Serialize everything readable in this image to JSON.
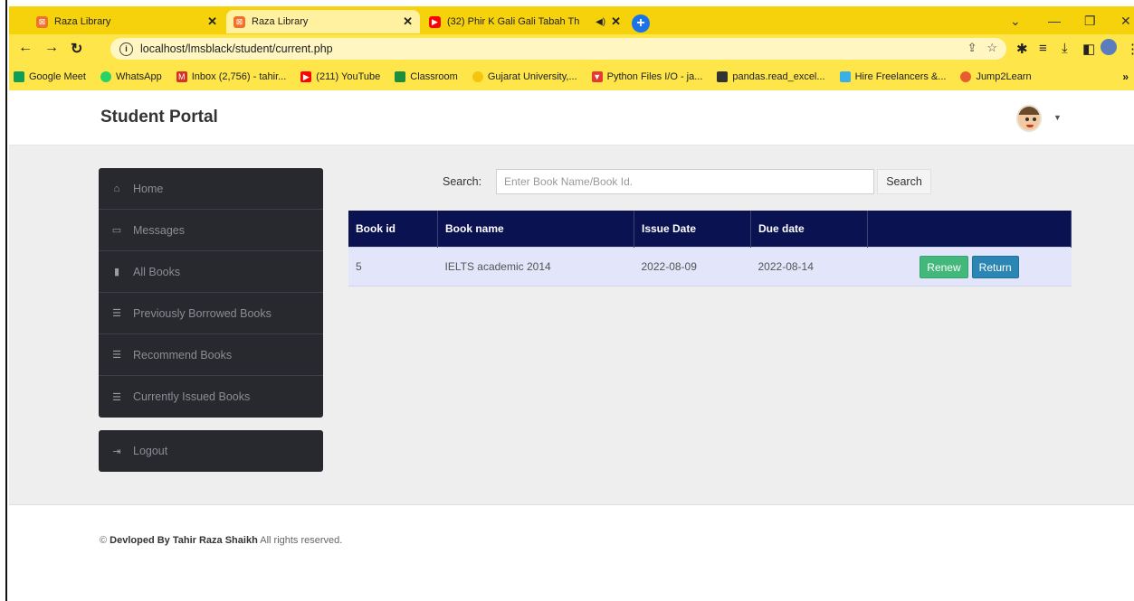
{
  "browser": {
    "tabs": [
      {
        "title": "Raza Library",
        "favicon_color": "#f0712c",
        "active": false
      },
      {
        "title": "Raza Library",
        "favicon_color": "#f0712c",
        "active": true
      },
      {
        "title": "(32) Phir K Gali Gali Tabah Th",
        "favicon_color": "#ff0000",
        "active": false
      }
    ],
    "url": "localhost/lmsblack/student/current.php",
    "bookmarks": [
      {
        "label": "Google Meet",
        "color": "#0f9d58"
      },
      {
        "label": "WhatsApp",
        "color": "#25d366"
      },
      {
        "label": "Inbox (2,756) - tahir...",
        "color": "#d93025"
      },
      {
        "label": "(211) YouTube",
        "color": "#ff0000"
      },
      {
        "label": "Classroom",
        "color": "#1e8e3e"
      },
      {
        "label": "Gujarat University,...",
        "color": "#f5d20c"
      },
      {
        "label": "Python Files I/O - ja...",
        "color": "#e53935"
      },
      {
        "label": "pandas.read_excel...",
        "color": "#333333"
      },
      {
        "label": "Hire Freelancers &...",
        "color": "#3ab0e6"
      },
      {
        "label": "Jump2Learn",
        "color": "#e85d2f"
      }
    ]
  },
  "header": {
    "brand": "Student Portal"
  },
  "sidebar": {
    "items": [
      {
        "label": "Home",
        "icon": "home-icon"
      },
      {
        "label": "Messages",
        "icon": "inbox-icon"
      },
      {
        "label": "All Books",
        "icon": "book-icon"
      },
      {
        "label": "Previously Borrowed Books",
        "icon": "list-icon"
      },
      {
        "label": "Recommend Books",
        "icon": "list-icon"
      },
      {
        "label": "Currently Issued Books",
        "icon": "list-icon"
      }
    ],
    "logout": "Logout"
  },
  "search": {
    "label": "Search:",
    "placeholder": "Enter Book Name/Book Id.",
    "button": "Search"
  },
  "table": {
    "columns": [
      "Book id",
      "Book name",
      "Issue Date",
      "Due date"
    ],
    "rows": [
      {
        "id": "5",
        "name": "IELTS academic 2014",
        "issue_date": "2022-08-09",
        "due_date": "2022-08-14"
      }
    ],
    "renew_label": "Renew",
    "return_label": "Return"
  },
  "footer": {
    "copyright_symbol": "©",
    "author_prefix": "Devloped By Tahir Raza Shaikh",
    "suffix": "All rights reserved."
  }
}
